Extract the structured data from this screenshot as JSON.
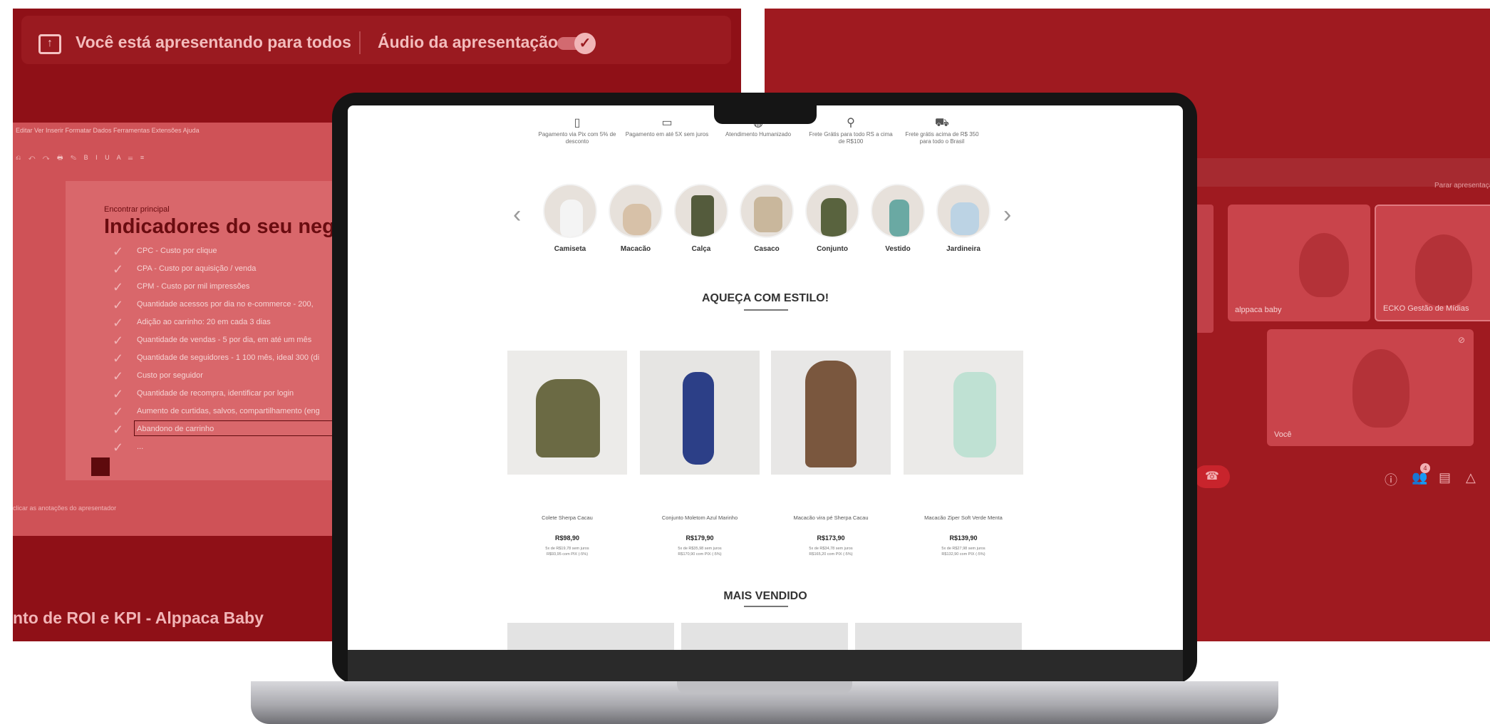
{
  "left_meet": {
    "presenting_text": "Você está apresentando para todos",
    "audio_label": "Áudio da apresentação",
    "doc_menu": "Editar  Ver  Inserir  Formatar  Dados  Ferramentas  Extensões  Ajuda",
    "doc_subheading": "Encontrar principal",
    "doc_title": "Indicadores do seu negó",
    "doc_items": [
      "CPC - Custo por clique",
      "CPA - Custo por aquisição / venda",
      "CPM - Custo por mil impressões",
      "Quantidade acessos por dia no e-commerce - 200,",
      "Adição ao carrinho: 20 em cada 3 dias",
      "Quantidade de vendas - 5 por dia, em até um mês",
      "Quantidade de seguidores - 1 100 mês, ideal 300 (di",
      "Custo por seguidor",
      "Quantidade de recompra, identificar por login",
      "Aumento de curtidas, salvos, compartilhamento (eng",
      "Abandono de carrinho",
      "..."
    ],
    "doc_footer": "clicar as anotações do apresentador",
    "presentation_title": "nto de ROI e KPI - Alppaca Baby"
  },
  "right_meet": {
    "stop_presenting": "Parar apresentação",
    "tiles": [
      {
        "name": "alppaca baby"
      },
      {
        "name": "ECKO Gestão de Mídias"
      },
      {
        "name": "Você"
      }
    ],
    "participant_count": "4"
  },
  "store": {
    "features": [
      {
        "icon": "phone-icon",
        "glyph": "▯",
        "text": "Pagamento via Pix com 5% de desconto"
      },
      {
        "icon": "card-icon",
        "glyph": "▭",
        "text": "Pagamento em até 5X sem juros"
      },
      {
        "icon": "chat-icon",
        "glyph": "◍",
        "text": "Atendimento Humanizado"
      },
      {
        "icon": "pin-icon",
        "glyph": "⚲",
        "text": "Frete Grátis para todo RS a cima de R$100"
      },
      {
        "icon": "truck-icon",
        "glyph": "⛟",
        "text": "Frete grátis acima de R$ 350 para todo o Brasil"
      }
    ],
    "categories": [
      "Camiseta",
      "Macacão",
      "Calça",
      "Casaco",
      "Conjunto",
      "Vestido",
      "Jardineira"
    ],
    "section1_title": "AQUEÇA COM ESTILO!",
    "products": [
      {
        "name": "Colete Sherpa Cacau",
        "price": "R$98,90",
        "installments": "5x de R$19,78 sem juros",
        "pix": "R$93,95 com PIX (-5%)"
      },
      {
        "name": "Conjunto Moletom Azul Marinho",
        "price": "R$179,90",
        "installments": "5x de R$35,98 sem juros",
        "pix": "R$170,90 com PIX (-5%)"
      },
      {
        "name": "Macacão vira pé Sherpa Cacau",
        "price": "R$173,90",
        "installments": "5x de R$34,78 sem juros",
        "pix": "R$165,20 com PIX (-5%)"
      },
      {
        "name": "Macacão Ziper Soft Verde Menta",
        "price": "R$139,90",
        "installments": "5x de R$27,98 sem juros",
        "pix": "R$132,90 com PIX (-5%)"
      }
    ],
    "section2_title": "MAIS VENDIDO"
  },
  "colors": {
    "meet_red": "#8f1017",
    "meet_red_right": "#9f1a20",
    "laptop_bezel": "#151515"
  }
}
